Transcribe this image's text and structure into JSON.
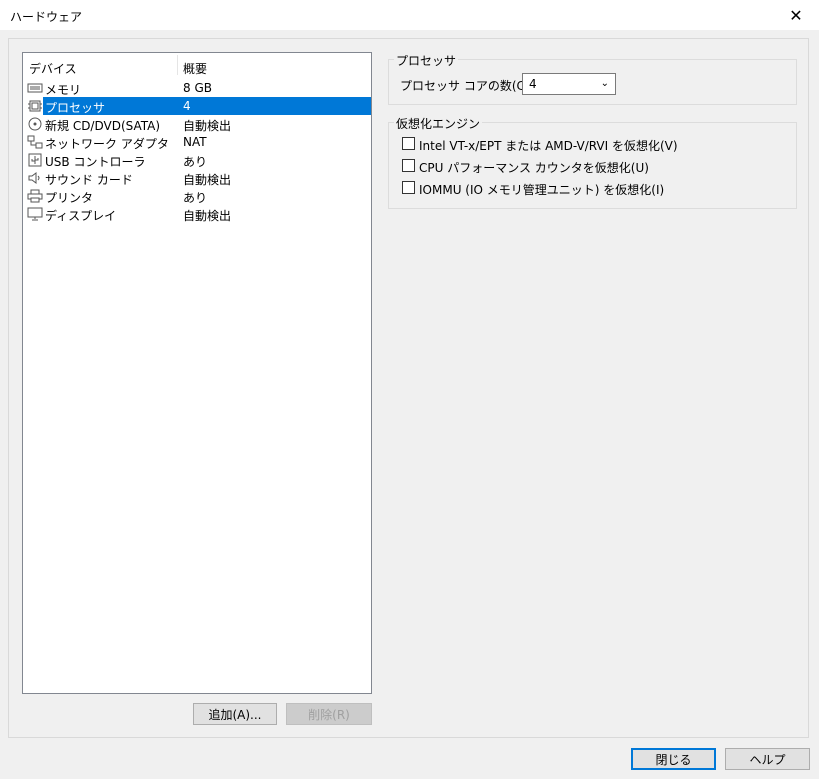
{
  "window": {
    "title": "ハードウェア"
  },
  "device_list": {
    "col_device": "デバイス",
    "col_summary": "概要",
    "items": [
      {
        "name": "メモリ",
        "summary": "8 GB",
        "icon": "memory-icon"
      },
      {
        "name": "プロセッサ",
        "summary": "4",
        "icon": "processor-icon",
        "selected": true
      },
      {
        "name": "新規 CD/DVD(SATA)",
        "summary": "自動検出",
        "icon": "cd-dvd-icon"
      },
      {
        "name": "ネットワーク アダプタ",
        "summary": "NAT",
        "icon": "network-adapter-icon"
      },
      {
        "name": "USB コントローラ",
        "summary": "あり",
        "icon": "usb-icon"
      },
      {
        "name": "サウンド カード",
        "summary": "自動検出",
        "icon": "speaker-icon"
      },
      {
        "name": "プリンタ",
        "summary": "あり",
        "icon": "printer-icon"
      },
      {
        "name": "ディスプレイ",
        "summary": "自動検出",
        "icon": "display-icon"
      }
    ]
  },
  "buttons": {
    "add": "追加(A)...",
    "remove": "削除(R)",
    "close": "閉じる",
    "help": "ヘルプ"
  },
  "processor_group": {
    "title": "プロセッサ",
    "cores_label": "プロセッサ コアの数(C):",
    "cores_value": "4"
  },
  "virtualization_group": {
    "title": "仮想化エンジン",
    "options": [
      {
        "label": "Intel VT-x/EPT または AMD-V/RVI を仮想化(V)",
        "checked": false
      },
      {
        "label": "CPU パフォーマンス カウンタを仮想化(U)",
        "checked": false
      },
      {
        "label": "IOMMU (IO メモリ管理ユニット) を仮想化(I)",
        "checked": false
      }
    ]
  }
}
